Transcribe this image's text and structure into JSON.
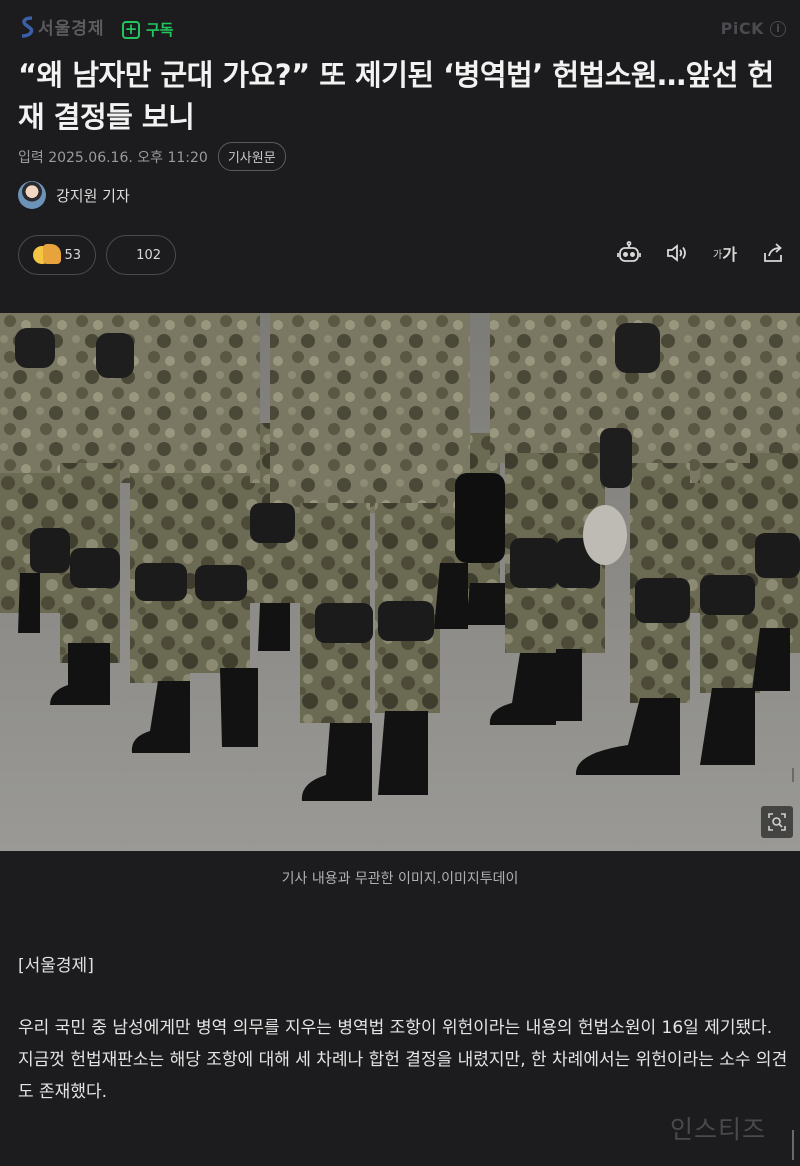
{
  "header": {
    "brand": "서울경제",
    "subscribe_label": "구독",
    "pick_label": "PiCK"
  },
  "article": {
    "title": "“왜 남자만 군대 가요?” 또 제기된 ‘병역법’ 헌법소원…앞선 헌재 결정들 보니",
    "date": "입력 2025.06.16. 오후 11:20",
    "original_button": "기사원문",
    "author": "강지원 기자",
    "reactions": {
      "emotion_count": "53",
      "comment_count": "102"
    },
    "image_caption": "기사 내용과 무관한 이미지.이미지투데이",
    "source": "[서울경제]",
    "body": "우리 국민 중 남성에게만 병역 의무를 지우는 병역법 조항이 위헌이라는 내용의 헌법소원이 16일 제기됐다. 지금껏 헌법재판소는 해당 조항에 대해 세 차례나 합헌 결정을 내렸지만, 한 차례에서는 위헌이라는 소수 의견도 존재했다."
  },
  "toolbar": {
    "font_small": "가",
    "font_large": "가"
  },
  "watermark": "인스티즈",
  "icons": [
    "brand-logo-icon",
    "plus-icon",
    "info-icon",
    "emoji-icon",
    "robot-icon",
    "speaker-icon",
    "font-size-icon",
    "share-icon",
    "zoom-icon"
  ],
  "colors": {
    "background": "#1c1c1e",
    "accent": "#22c55e"
  }
}
